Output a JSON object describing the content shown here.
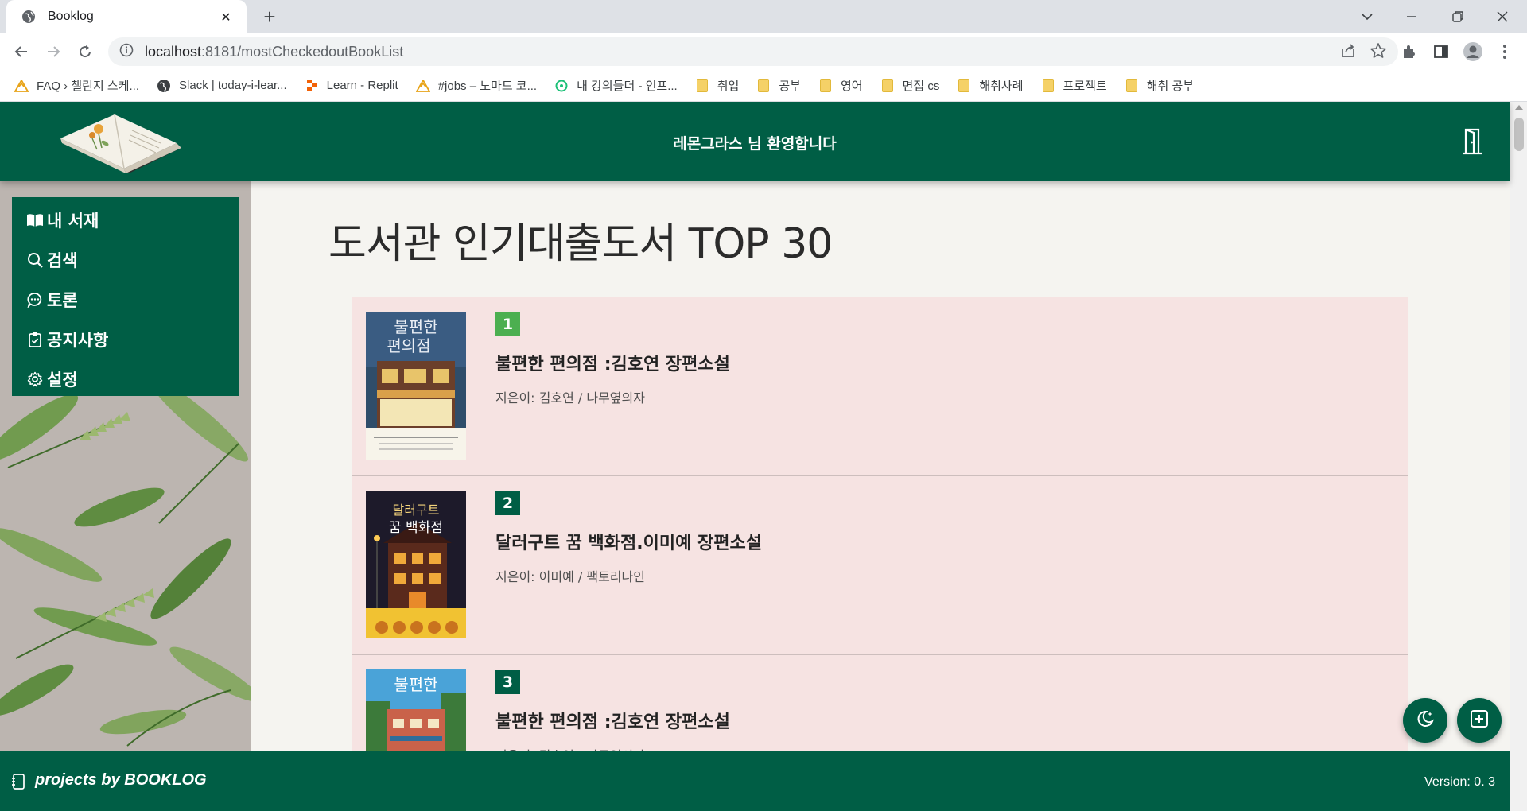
{
  "browser": {
    "tab_title": "Booklog",
    "tab_close": "✕",
    "new_tab": "+",
    "url_host": "localhost",
    "url_path": ":8181/mostCheckedoutBookList",
    "bookmarks": [
      {
        "label": "FAQ › 챌린지 스케...",
        "icon": "warning-icon"
      },
      {
        "label": "Slack | today-i-lear...",
        "icon": "globe-icon"
      },
      {
        "label": "Learn - Replit",
        "icon": "replit-icon"
      },
      {
        "label": "#jobs – 노마드 코...",
        "icon": "warning-icon"
      },
      {
        "label": "내 강의들더 - 인프...",
        "icon": "inflearn-icon"
      },
      {
        "label": "취업",
        "icon": "folder-icon"
      },
      {
        "label": "공부",
        "icon": "folder-icon"
      },
      {
        "label": "영어",
        "icon": "folder-icon"
      },
      {
        "label": "면접 cs",
        "icon": "folder-icon"
      },
      {
        "label": "해취사례",
        "icon": "folder-icon"
      },
      {
        "label": "프로젝트",
        "icon": "folder-icon"
      },
      {
        "label": "해취 공부",
        "icon": "folder-icon"
      }
    ]
  },
  "header": {
    "welcome": "레몬그라스 님 환영합니다"
  },
  "sidebar": {
    "items": [
      {
        "label": "내 서재",
        "icon": "book-open-icon"
      },
      {
        "label": "검색",
        "icon": "search-icon"
      },
      {
        "label": "토론",
        "icon": "chat-icon"
      },
      {
        "label": "공지사항",
        "icon": "clipboard-icon"
      },
      {
        "label": "설정",
        "icon": "gear-icon"
      }
    ]
  },
  "main": {
    "title": "도서관 인기대출도서 TOP 30",
    "books": [
      {
        "rank": "1",
        "title": "불편한 편의점 :김호연 장편소설",
        "author": "지은이: 김호연 / 나무옆의자",
        "rank_color": "#4caf50"
      },
      {
        "rank": "2",
        "title": "달러구트 꿈 백화점.이미예 장편소설",
        "author": "지은이: 이미예 / 팩토리나인",
        "rank_color": "#005e45"
      },
      {
        "rank": "3",
        "title": "불편한 편의점 :김호연 장편소설",
        "author": "지은이: 김호연 / 나무옆의자",
        "rank_color": "#005e45"
      }
    ]
  },
  "footer": {
    "brand": "projects by BOOKLOG",
    "version": "Version: 0. 3"
  },
  "colors": {
    "primary": "#005e45",
    "list_bg": "#f6e3e2",
    "page_bg": "#f5f4f0"
  }
}
